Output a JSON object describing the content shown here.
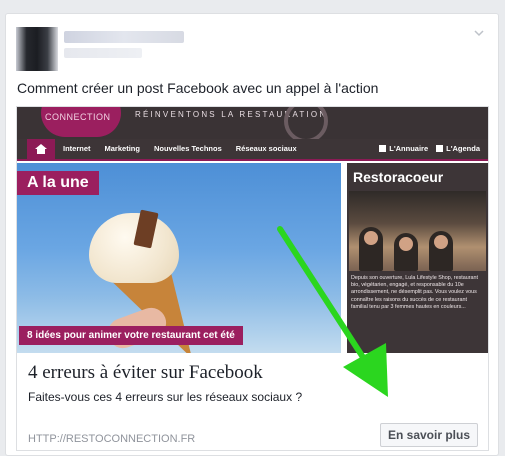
{
  "post": {
    "text": "Comment créer un post Facebook avec un appel à l'action"
  },
  "site": {
    "logo_text": "CONNECTION",
    "tagline": "RÉINVENTONS LA RESTAURATION",
    "nav": {
      "items": [
        "Internet",
        "Marketing",
        "Nouvelles Technos",
        "Réseaux sociaux"
      ],
      "right_items": [
        "L'Annuaire",
        "L'Agenda"
      ]
    },
    "hero": {
      "tag": "A la une",
      "caption": "8 idées pour animer votre restaurant cet été"
    },
    "side": {
      "title": "Restoracoeur",
      "body": "Depuis son ouverture, Lula Lifestyle Shop, restaurant bio, végétarien, engagé, et responsable du 10e arrondissement, ne désemplit pas. Vous voulez vous connaître les raisons du succès de ce restaurant familial tenu par 3 femmes hautes en couleurs..."
    }
  },
  "link": {
    "title": "4 erreurs à éviter sur Facebook",
    "description": "Faites-vous ces 4 erreurs sur les réseaux sociaux ?",
    "url": "HTTP://RESTOCONNECTION.FR",
    "cta_label": "En savoir plus"
  },
  "colors": {
    "brand": "#9b1f5f",
    "annotation_arrow": "#2bd61f"
  }
}
